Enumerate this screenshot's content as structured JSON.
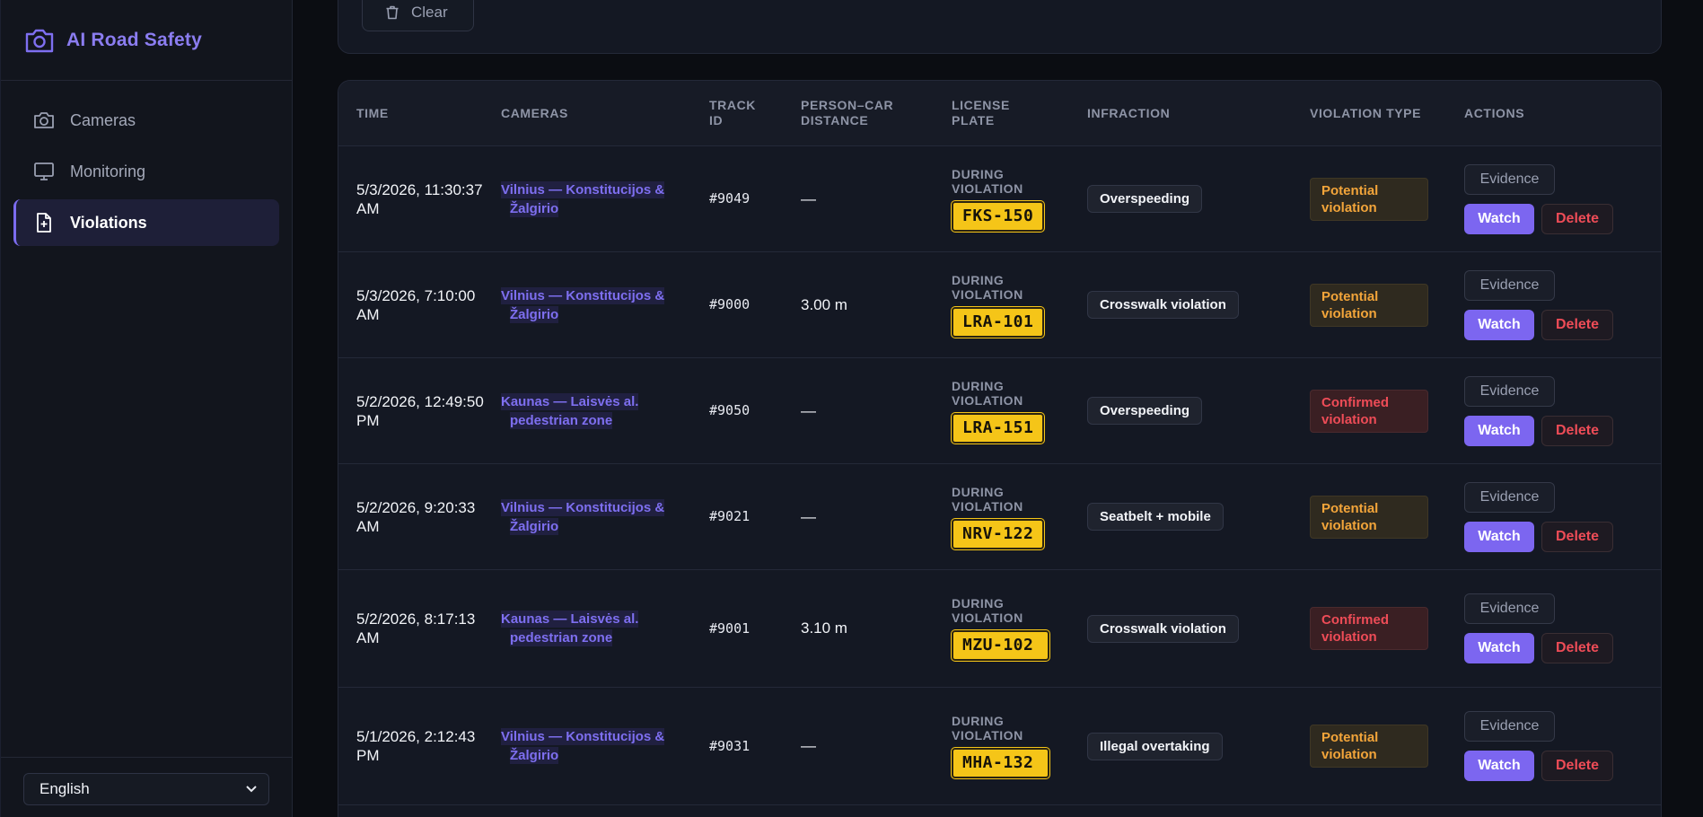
{
  "sidebar": {
    "brand": "AI Road Safety",
    "items": [
      {
        "label": "Cameras",
        "icon": "camera-icon"
      },
      {
        "label": "Monitoring",
        "icon": "monitor-icon"
      },
      {
        "label": "Violations",
        "icon": "file-plus-icon",
        "active": true
      }
    ],
    "language": "English"
  },
  "filters": {
    "clear_label": "Clear"
  },
  "table": {
    "headers": {
      "time": "TIME",
      "cameras": "CAMERAS",
      "track_id": "TRACK ID",
      "distance": "PERSON–CAR DISTANCE",
      "plate": "LICENSE PLATE",
      "infraction": "INFRACTION",
      "violation_type": "VIOLATION TYPE",
      "actions": "ACTIONS"
    },
    "plate_label": "DURING VIOLATION",
    "evidence_label": "Evidence",
    "watch_label": "Watch",
    "delete_label": "Delete",
    "rows": [
      {
        "time": "5/3/2026, 11:30:37 AM",
        "camera": "Vilnius — Konstitucijos & Žalgirio",
        "track": "#9049",
        "distance": "—",
        "plate": "FKS-150",
        "infraction": "Overspeeding",
        "type": "Potential violation"
      },
      {
        "time": "5/3/2026, 7:10:00 AM",
        "camera": "Vilnius — Konstitucijos & Žalgirio",
        "track": "#9000",
        "distance": "3.00 m",
        "plate": "LRA-101",
        "infraction": "Crosswalk violation",
        "type": "Potential violation"
      },
      {
        "time": "5/2/2026, 12:49:50 PM",
        "camera": "Kaunas — Laisvės al. pedestrian zone",
        "track": "#9050",
        "distance": "—",
        "plate": "LRA-151",
        "infraction": "Overspeeding",
        "type": "Confirmed violation"
      },
      {
        "time": "5/2/2026, 9:20:33 AM",
        "camera": "Vilnius — Konstitucijos & Žalgirio",
        "track": "#9021",
        "distance": "—",
        "plate": "NRV-122",
        "infraction": "Seatbelt + mobile",
        "type": "Potential violation"
      },
      {
        "time": "5/2/2026, 8:17:13 AM",
        "camera": "Kaunas — Laisvės al. pedestrian zone",
        "track": "#9001",
        "distance": "3.10 m",
        "plate": "MZU-102",
        "infraction": "Crosswalk violation",
        "type": "Confirmed violation"
      },
      {
        "time": "5/1/2026, 2:12:43 PM",
        "camera": "Vilnius — Konstitucijos & Žalgirio",
        "track": "#9031",
        "distance": "—",
        "plate": "MHA-132",
        "infraction": "Illegal overtaking",
        "type": "Potential violation"
      }
    ]
  },
  "colors": {
    "accent": "#7c66f0",
    "potential": "#f3a53a",
    "confirmed": "#ee4c57",
    "plate": "#f5c518"
  }
}
